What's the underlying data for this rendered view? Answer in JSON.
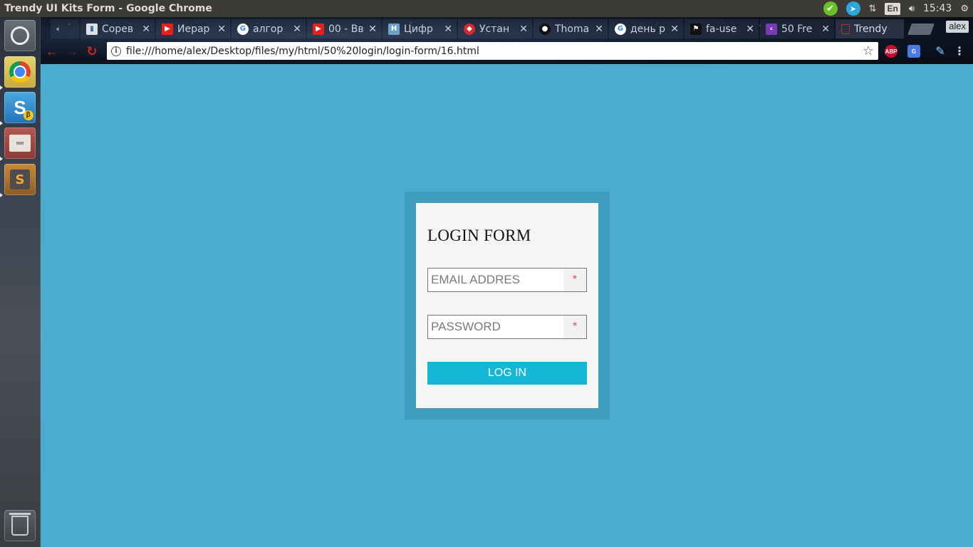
{
  "window": {
    "title": "Trendy UI Kits Form - Google Chrome"
  },
  "system_tray": {
    "keyboard_layout": "En",
    "clock": "15:43"
  },
  "browser": {
    "profile_name": "alex",
    "tabs": [
      {
        "label": "Сорев",
        "favicon": "chart-favicon",
        "color": "#e0e0e0"
      },
      {
        "label": "Иерар",
        "favicon": "youtube-favicon",
        "color": "#e62117"
      },
      {
        "label": "алгор",
        "favicon": "google-favicon",
        "color": "#ffffff"
      },
      {
        "label": "00 - Вв",
        "favicon": "youtube-favicon",
        "color": "#e62117"
      },
      {
        "label": "Цифр",
        "favicon": "h-favicon",
        "color": "#6fa3c8"
      },
      {
        "label": "Устан",
        "favicon": "ruby-favicon",
        "color": "#d62a2a"
      },
      {
        "label": "Thoma",
        "favicon": "github-favicon",
        "color": "#111111"
      },
      {
        "label": "день р",
        "favicon": "google-favicon",
        "color": "#ffffff"
      },
      {
        "label": "fa-use",
        "favicon": "flag-favicon",
        "color": "#111111"
      },
      {
        "label": "50 Fre",
        "favicon": "colorlib-favicon",
        "color": "#7a3ab5"
      },
      {
        "label": "Trendy",
        "favicon": "page-favicon",
        "color": "#c62828",
        "active": true
      }
    ],
    "address_bar": {
      "url": "file:///home/alex/Desktop/files/my/html/50%20login/login-form/16.html"
    },
    "extensions": [
      "adblock-plus",
      "google-translate",
      "color-picker"
    ],
    "extension_labels": {
      "abp": "ABP"
    }
  },
  "page": {
    "form_title": "LOGIN FORM",
    "email_placeholder": "EMAIL ADDRES",
    "password_placeholder": "PASSWORD",
    "required_marker": "*",
    "login_button": "LOG IN",
    "colors": {
      "background": "#4aadcf",
      "frame": "#3e9cbc",
      "card": "#f5f5f5",
      "button": "#16b6d6",
      "required": "#e24a4a"
    }
  }
}
